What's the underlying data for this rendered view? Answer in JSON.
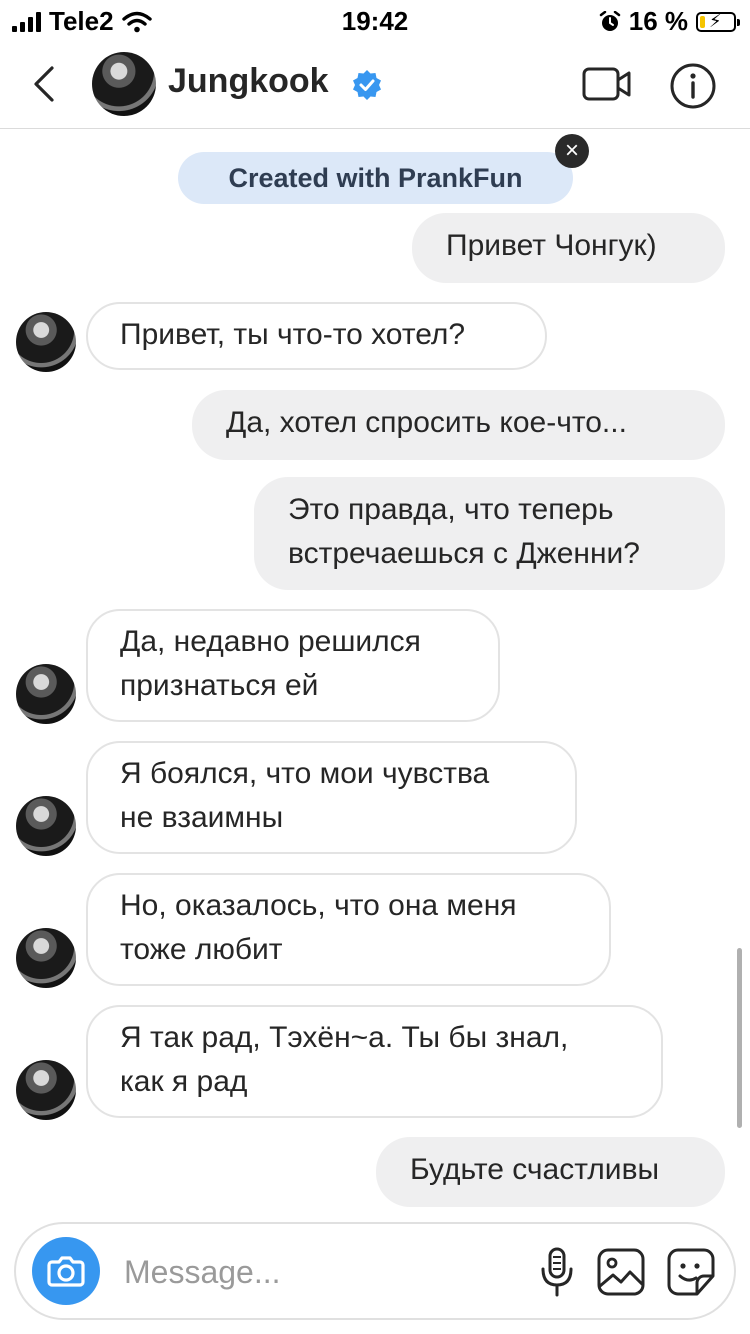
{
  "status_bar": {
    "carrier": "Tele2",
    "time": "19:42",
    "battery_percent": "16 %",
    "battery_level": 0.16
  },
  "header": {
    "contact_name": "Jungkook",
    "verified": true
  },
  "banner": {
    "text": "Created with PrankFun"
  },
  "messages": [
    {
      "direction": "outgoing",
      "text": "Привет Чонгук)"
    },
    {
      "direction": "incoming",
      "text": "Привет, ты что-то хотел?"
    },
    {
      "direction": "outgoing",
      "text": "Да, хотел спросить кое-что..."
    },
    {
      "direction": "outgoing",
      "lines": [
        "Это правда, что теперь",
        "встречаешься с Дженни?"
      ]
    },
    {
      "direction": "incoming",
      "lines": [
        "Да, недавно решился",
        "признаться ей"
      ]
    },
    {
      "direction": "incoming",
      "lines": [
        "Я боялся, что мои чувства",
        "не взаимны"
      ]
    },
    {
      "direction": "incoming",
      "lines": [
        "Но, оказалось, что она меня",
        "тоже любит"
      ]
    },
    {
      "direction": "incoming",
      "lines": [
        "Я так рад, Тэхён~а. Ты бы знал,",
        "как я рад"
      ]
    },
    {
      "direction": "outgoing",
      "text": "Будьте счастливы"
    }
  ],
  "composer": {
    "placeholder": "Message..."
  },
  "colors": {
    "accent_blue": "#3797f0",
    "verified_blue": "#3897f0",
    "banner_bg": "#dce8f8",
    "outgoing_bubble": "#efeff0",
    "battery_fill": "#f5c400"
  }
}
